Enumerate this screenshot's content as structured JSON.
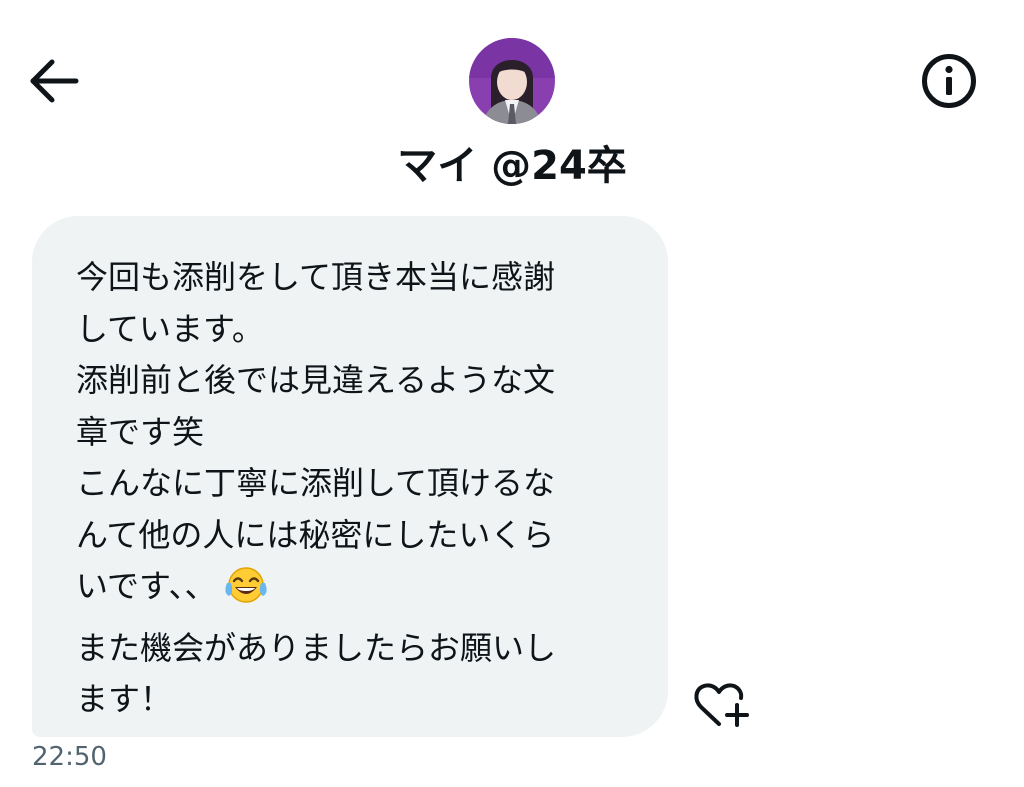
{
  "header": {
    "back_icon": "arrow-left-icon",
    "info_icon": "info-circle-icon",
    "contact_name": "マイ @24卒"
  },
  "message": {
    "lines": [
      "今回も添削をして頂き本当に感謝",
      "しています。",
      "添削前と後では見違えるような文",
      "章です笑",
      "こんなに丁寧に添削して頂けるな",
      "んて他の人には秘密にしたいくら",
      "いです、、",
      "また機会がありましたらお願いし",
      "ます！"
    ],
    "emoji": "face-with-tears-of-joy",
    "timestamp": "22:50",
    "reaction_icon": "heart-plus-icon"
  },
  "colors": {
    "bubble_bg": "#eff3f4",
    "text": "#0f1419",
    "muted": "#536471",
    "avatar_purple": "#8a3fb0"
  }
}
